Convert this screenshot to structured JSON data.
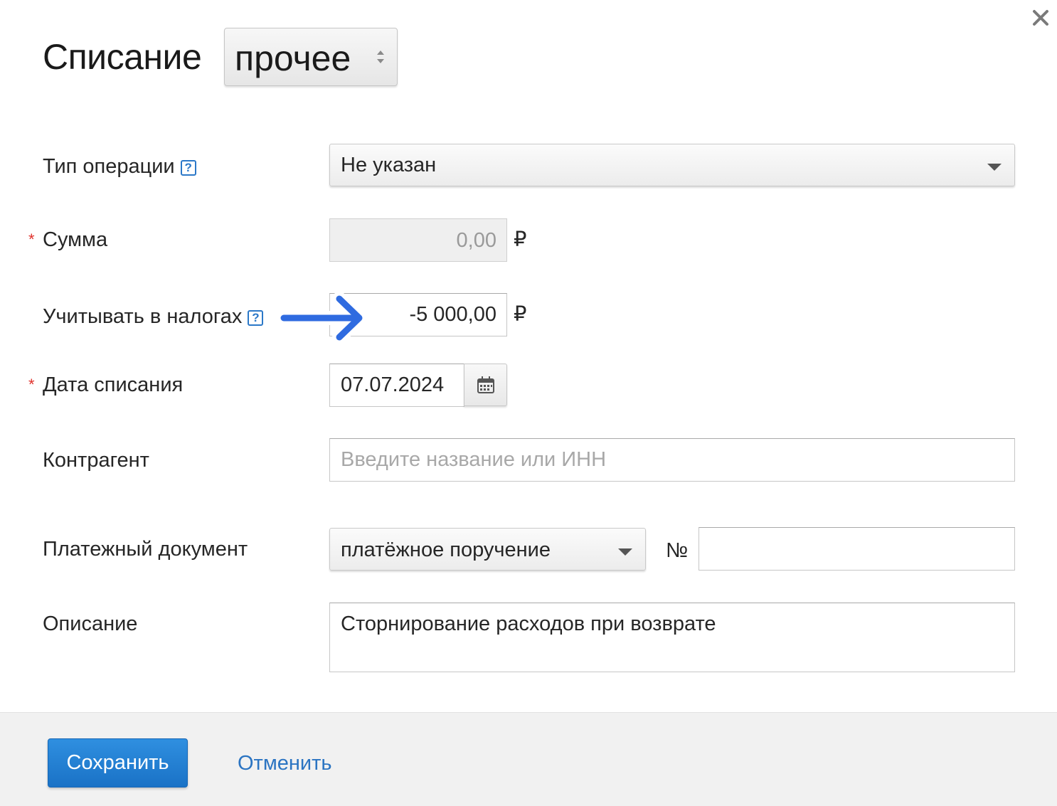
{
  "dialog": {
    "title": "Списание",
    "type_select": {
      "value": "прочее"
    },
    "close_icon": "close-icon"
  },
  "fields": {
    "operation_type": {
      "label": "Тип операции",
      "value": "Не указан"
    },
    "amount": {
      "label": "Сумма",
      "value": "0,00",
      "currency": "₽",
      "required": true
    },
    "tax_amount": {
      "label": "Учитывать в налогах",
      "value": "-5 000,00",
      "currency": "₽"
    },
    "date": {
      "label": "Дата списания",
      "value": "07.07.2024",
      "required": true
    },
    "counterparty": {
      "label": "Контрагент",
      "placeholder": "Введите название или ИНН",
      "value": ""
    },
    "payment_doc": {
      "label": "Платежный документ",
      "value": "платёжное поручение",
      "number_label": "№",
      "number_value": ""
    },
    "description": {
      "label": "Описание",
      "value": "Сторнирование расходов при возврате"
    }
  },
  "footer": {
    "save_label": "Сохранить",
    "cancel_label": "Отменить"
  },
  "colors": {
    "primary": "#1a72c6",
    "link": "#2b74c2",
    "required": "#e0312b",
    "annotation_arrow": "#2f6be0"
  }
}
